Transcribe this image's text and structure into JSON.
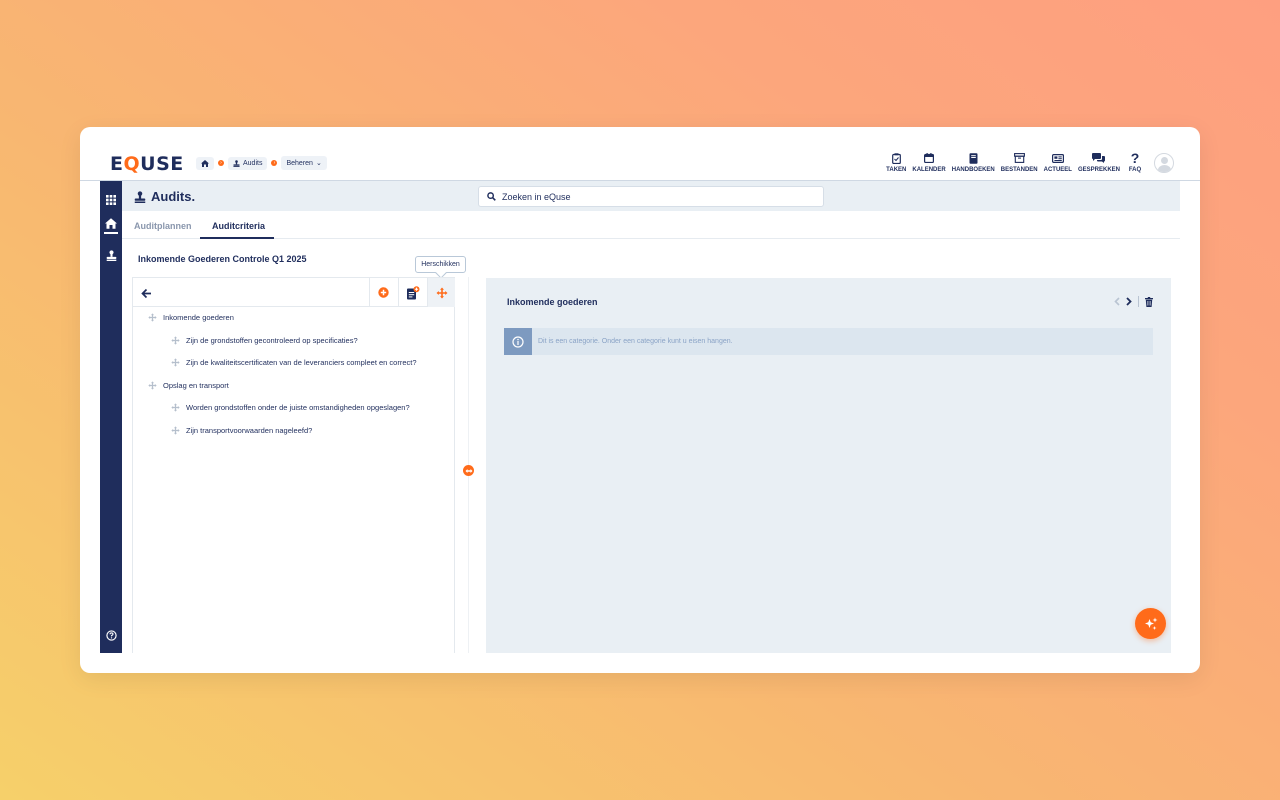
{
  "brand": {
    "logo_prefix": "E",
    "logo_q": "Q",
    "logo_suffix": "USE"
  },
  "breadcrumb": {
    "module": "Audits",
    "current": "Beheren"
  },
  "topnav": [
    {
      "label": "TAKEN",
      "icon": "clipboard-icon"
    },
    {
      "label": "KALENDER",
      "icon": "calendar-icon"
    },
    {
      "label": "HANDBOEKEN",
      "icon": "book-icon"
    },
    {
      "label": "BESTANDEN",
      "icon": "archive-icon"
    },
    {
      "label": "ACTUEEL",
      "icon": "newspaper-icon"
    },
    {
      "label": "GESPREKKEN",
      "icon": "comments-icon"
    },
    {
      "label": "FAQ",
      "icon": "question-icon"
    }
  ],
  "app": {
    "title": "Audits."
  },
  "search": {
    "placeholder": "Zoeken in eQuse"
  },
  "tabs": [
    {
      "label": "Auditplannen",
      "active": false
    },
    {
      "label": "Auditcriteria",
      "active": true
    }
  ],
  "audit": {
    "title": "Inkomende Goederen Controle Q1 2025"
  },
  "tooltip": {
    "text": "Herschikken"
  },
  "tree": [
    {
      "label": "Inkomende goederen",
      "level": 0
    },
    {
      "label": "Zijn de grondstoffen gecontroleerd op specificaties?",
      "level": 1
    },
    {
      "label": "Zijn de kwaliteitscertificaten van de leveranciers compleet en correct?",
      "level": 1
    },
    {
      "label": "Opslag en transport",
      "level": 0
    },
    {
      "label": "Worden grondstoffen onder de juiste omstandigheden opgeslagen?",
      "level": 1
    },
    {
      "label": "Zijn transportvoorwaarden nageleefd?",
      "level": 1
    }
  ],
  "detail": {
    "title": "Inkomende goederen",
    "info": "Dit is een categorie. Onder een categorie kunt u eisen hangen."
  },
  "colors": {
    "primary": "#1f2d5c",
    "accent": "#ff6b1a",
    "panel_bg": "#e9eff4"
  }
}
